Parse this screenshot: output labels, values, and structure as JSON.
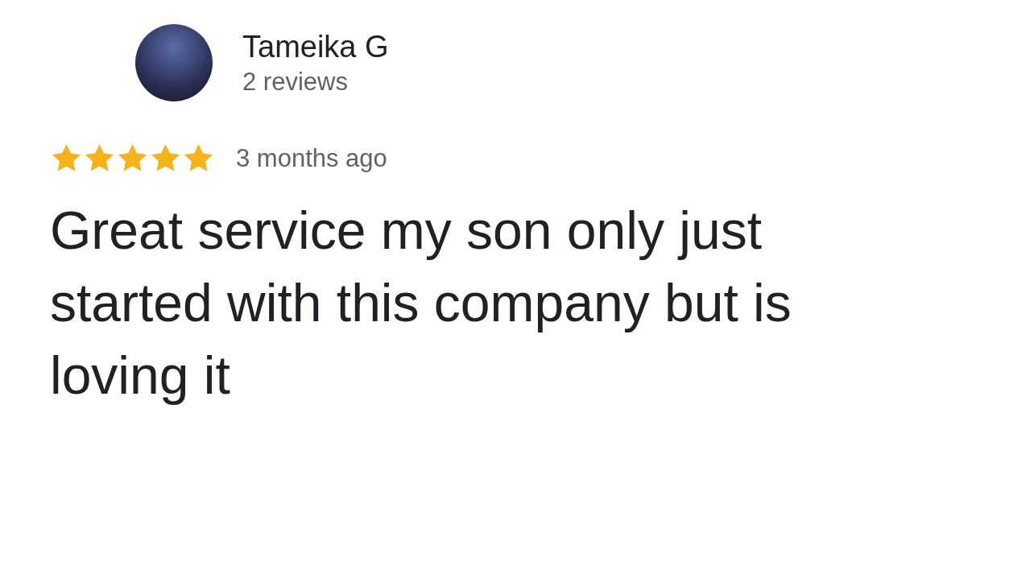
{
  "reviewer": {
    "name": "Tameika G",
    "reviews": "2 reviews"
  },
  "review": {
    "stars": 5,
    "time": "3 months ago",
    "text": "Great service my son only just started with this company but is loving it"
  }
}
